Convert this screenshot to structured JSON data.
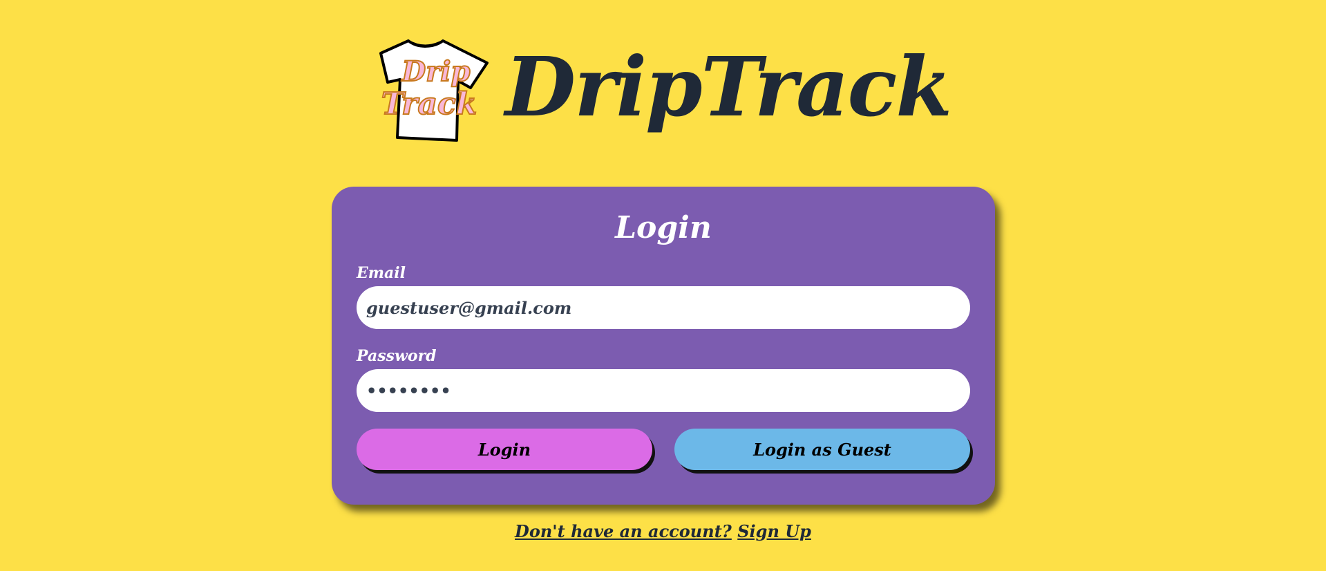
{
  "colors": {
    "background": "#FDE047",
    "card": "#7C5CB0",
    "title_text": "#1F2937",
    "login_button": "#DB6BE6",
    "guest_button": "#6CB8E8",
    "logo_text_fill": "#F9B8D8",
    "logo_text_outline": "#C8791E"
  },
  "header": {
    "brand_title": "DripTrack",
    "logo": {
      "icon": "tshirt-logo-icon",
      "line1": "Drip",
      "line2": "Track"
    }
  },
  "login_card": {
    "title": "Login",
    "email": {
      "label": "Email",
      "value": "guestuser@gmail.com"
    },
    "password": {
      "label": "Password",
      "value": "••••••••"
    },
    "login_button": "Login",
    "guest_button": "Login as Guest"
  },
  "signup": {
    "prompt": "Don't have an account?",
    "link": "Sign Up"
  }
}
